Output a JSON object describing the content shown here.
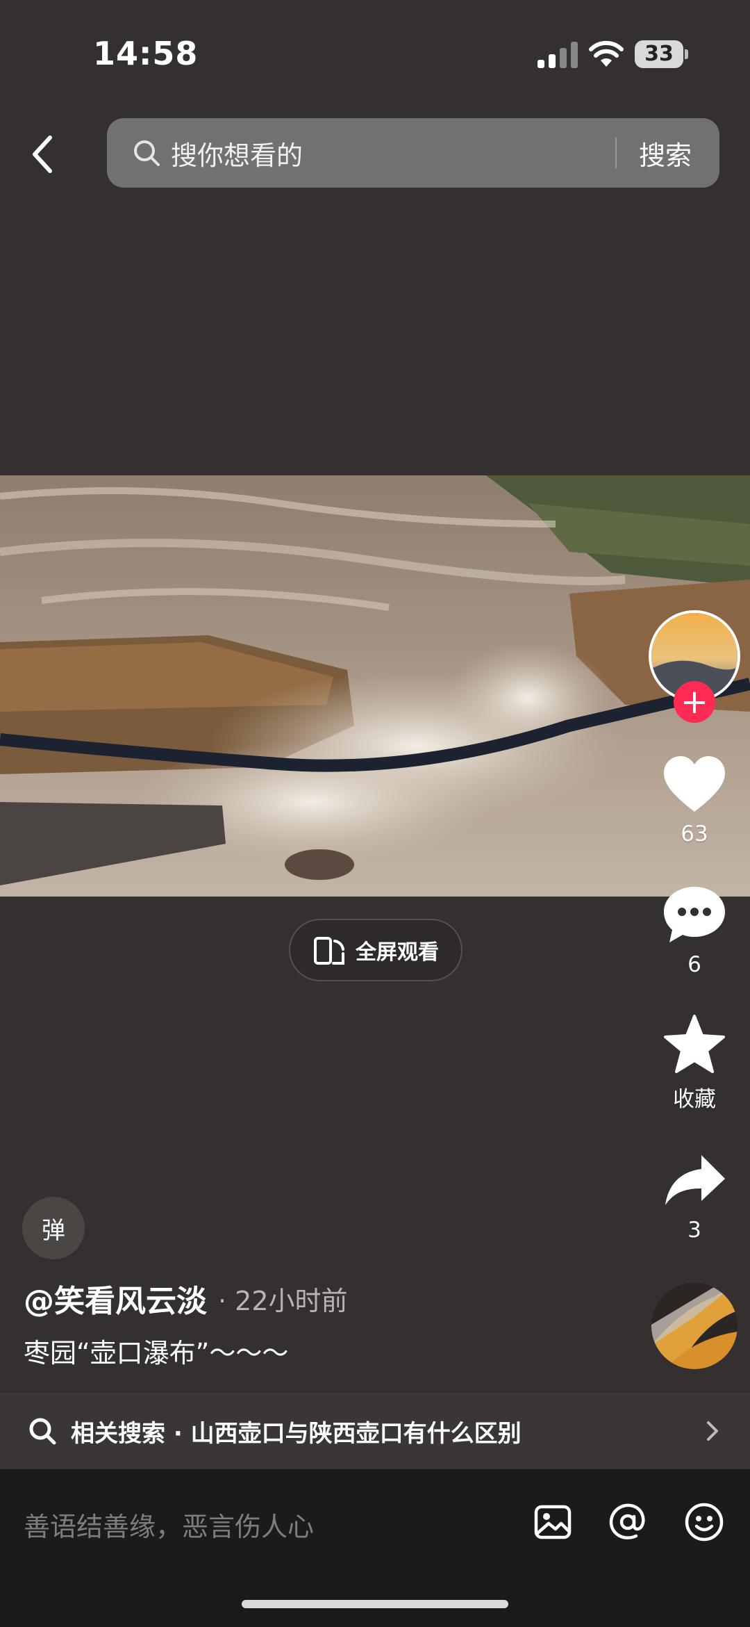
{
  "status": {
    "time": "14:58",
    "battery": "33"
  },
  "search": {
    "placeholder": "搜你想看的",
    "button": "搜索"
  },
  "video": {
    "fullscreen_label": "全屏观看"
  },
  "rail": {
    "like_count": "63",
    "comment_count": "6",
    "favorite_label": "收藏",
    "share_count": "3",
    "follow_symbol": "+"
  },
  "danmu": {
    "label": "弹"
  },
  "post": {
    "author": "@笑看风云淡",
    "time": "· 22小时前",
    "description": "枣园“壶口瀑布”～～～"
  },
  "related": {
    "text": "相关搜索 · 山西壶口与陕西壶口有什么区别"
  },
  "comment_bar": {
    "placeholder": "善语结善缘，恶言伤人心"
  },
  "icons": [
    "back-icon",
    "search-icon",
    "fullscreen-icon",
    "heart-icon",
    "comment-icon",
    "star-icon",
    "share-icon",
    "image-icon",
    "at-icon",
    "emoji-icon",
    "chevron-right-icon"
  ],
  "colors": {
    "accent": "#fe2c55",
    "background": "#34302f",
    "bottom_bar": "#1c1b1b"
  }
}
